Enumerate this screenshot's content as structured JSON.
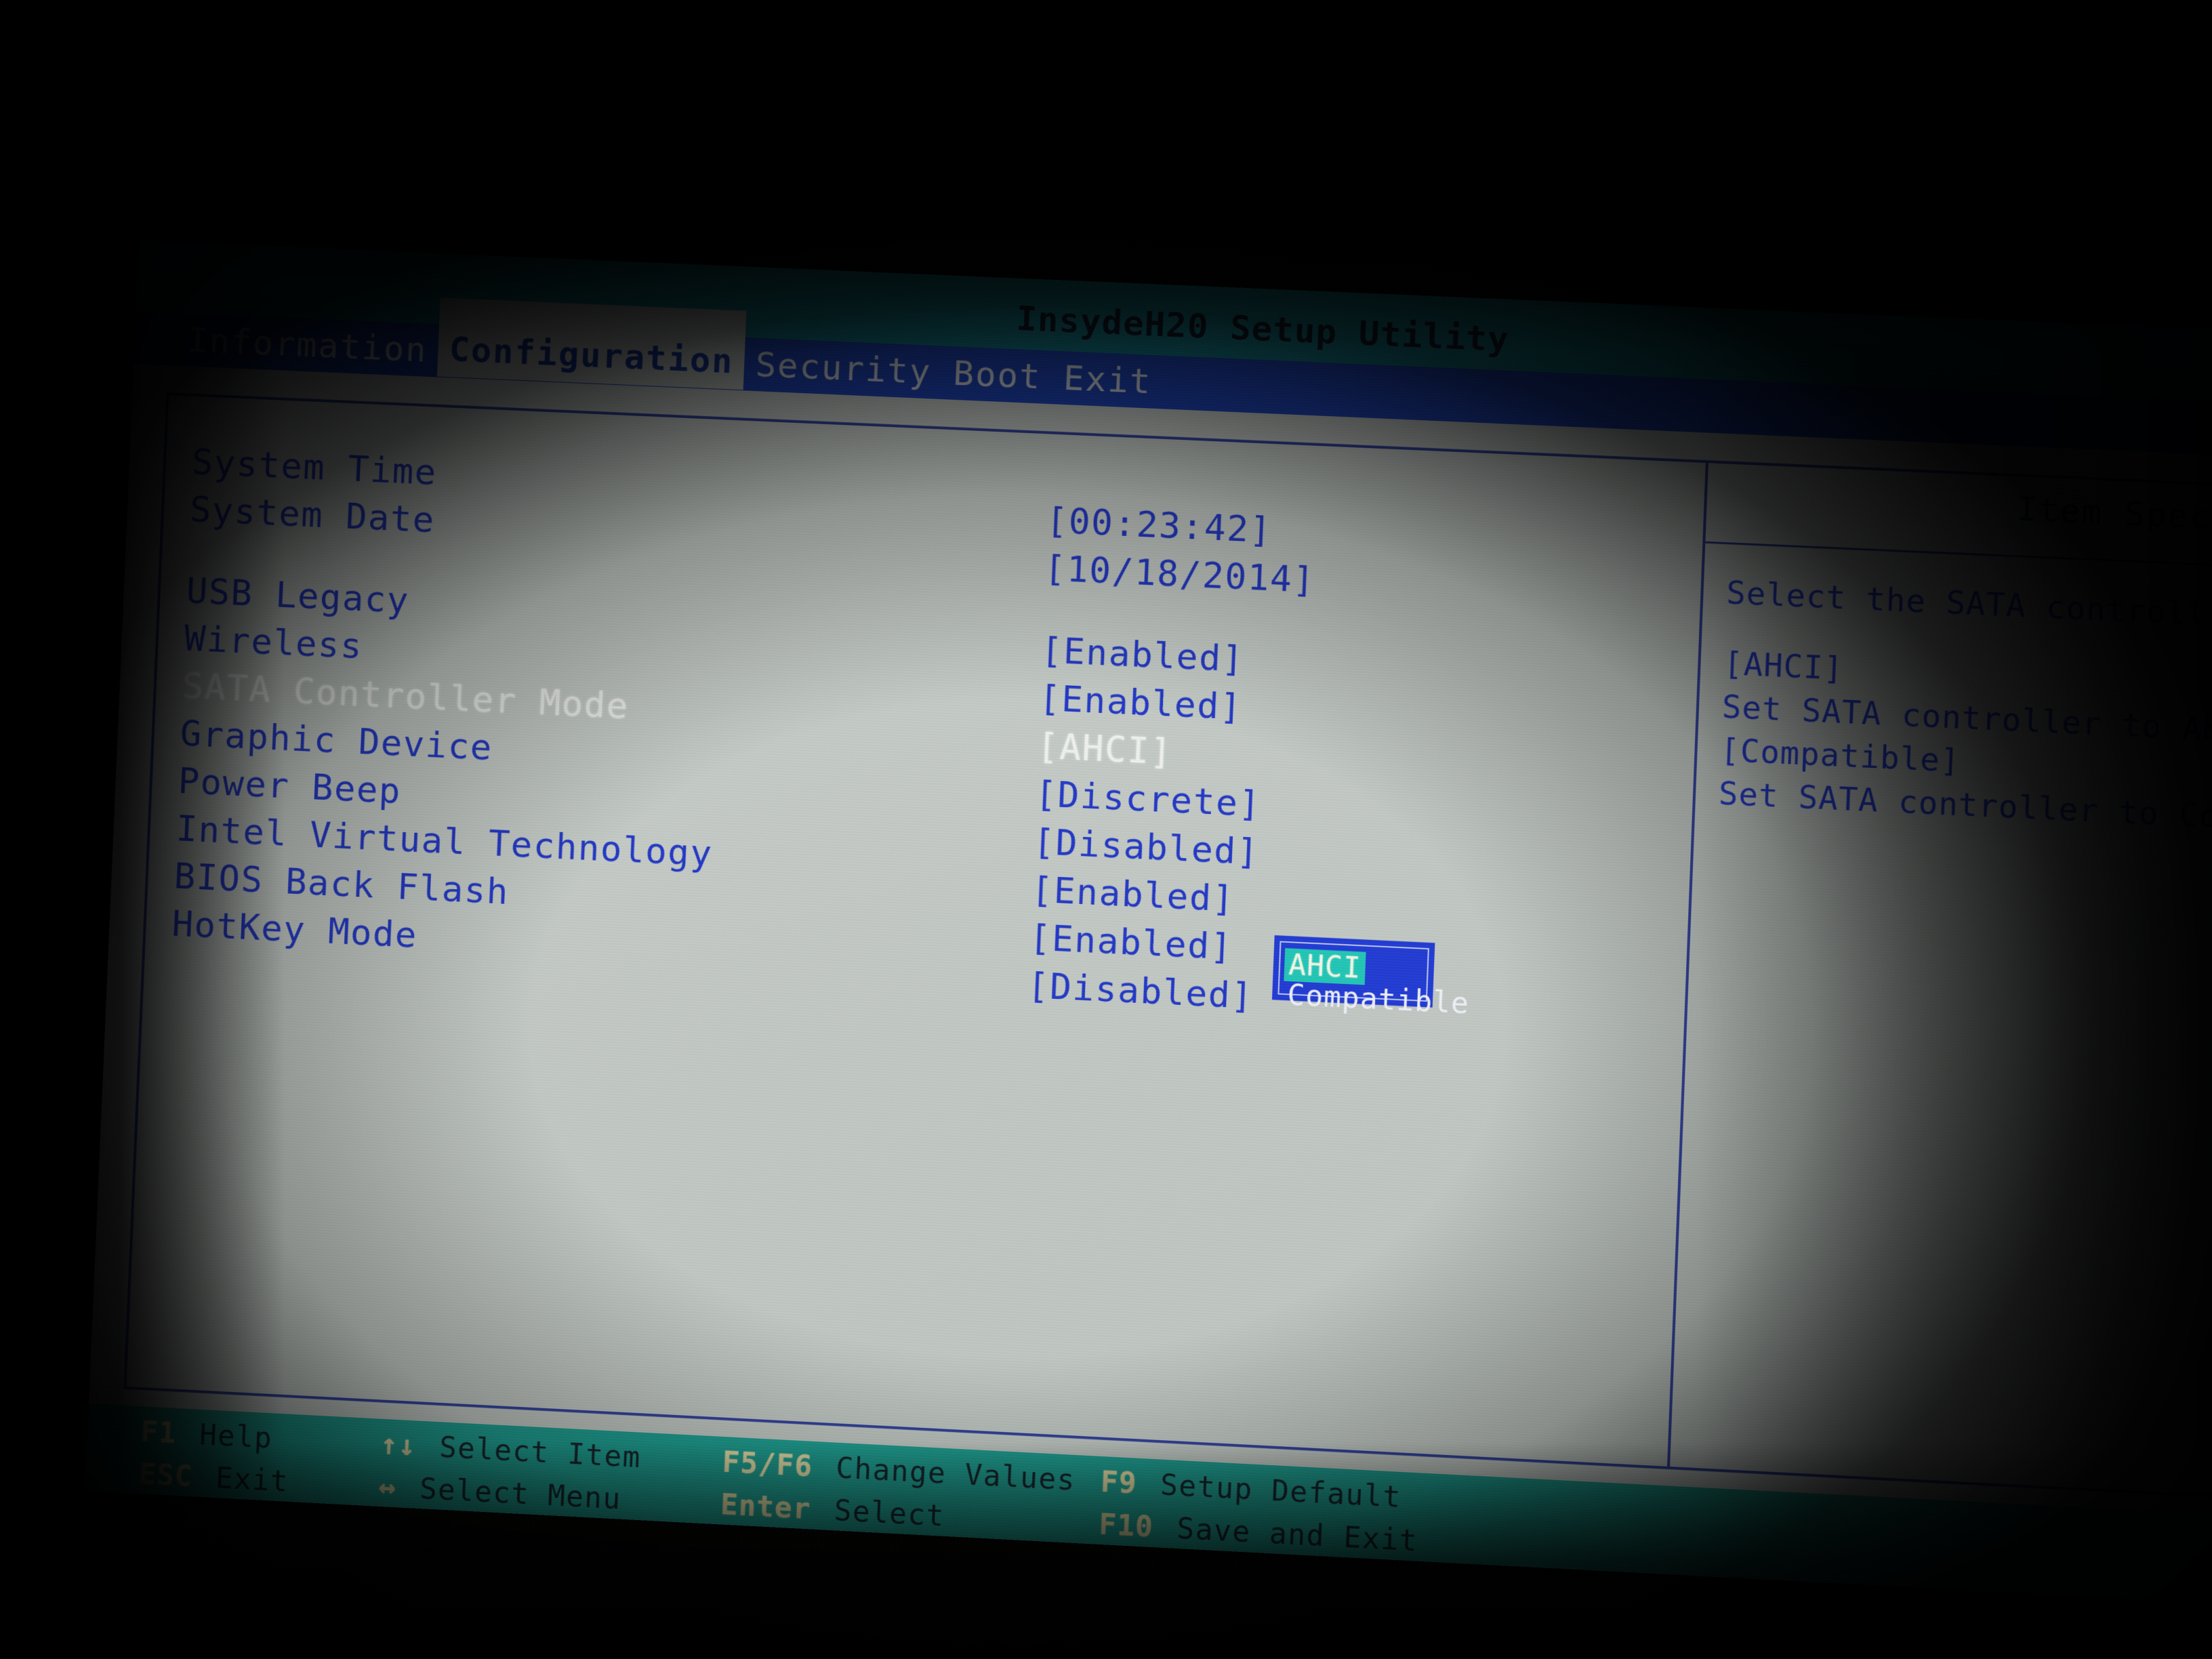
{
  "app": {
    "title": "InsydeH20 Setup Utility"
  },
  "menu": {
    "items": [
      {
        "label": "Information",
        "active": false
      },
      {
        "label": "Configuration",
        "active": true
      },
      {
        "label": "Security",
        "active": false
      },
      {
        "label": "Boot",
        "active": false
      },
      {
        "label": "Exit",
        "active": false
      }
    ]
  },
  "settings": {
    "rows": [
      {
        "label": "System Time",
        "value": "[00:23:42]",
        "selected": false,
        "gap": false
      },
      {
        "label": "System Date",
        "value": "[10/18/2014]",
        "selected": false,
        "gap": false
      },
      {
        "label": "USB Legacy",
        "value": "[Enabled]",
        "selected": false,
        "gap": true
      },
      {
        "label": "Wireless",
        "value": "[Enabled]",
        "selected": false,
        "gap": false
      },
      {
        "label": "SATA Controller Mode",
        "value": "[AHCI]",
        "selected": true,
        "gap": false
      },
      {
        "label": "Graphic Device",
        "value": "[Discrete]",
        "selected": false,
        "gap": false
      },
      {
        "label": "Power Beep",
        "value": "[Disabled]",
        "selected": false,
        "gap": false
      },
      {
        "label": "Intel Virtual Technology",
        "value": "[Enabled]",
        "selected": false,
        "gap": false
      },
      {
        "label": "BIOS Back Flash",
        "value": "[Enabled]",
        "selected": false,
        "gap": false
      },
      {
        "label": "HotKey Mode",
        "value": "[Disabled]",
        "selected": false,
        "gap": false
      }
    ]
  },
  "help": {
    "title": "Item Specific Help",
    "lines": [
      "Select the SATA controller mode.",
      "",
      "[AHCI]",
      "Set SATA controller to AHCI mode.",
      "[Compatible]",
      "Set SATA controller to Compatible mode."
    ]
  },
  "popup": {
    "options": [
      {
        "label": "AHCI",
        "highlighted": true
      },
      {
        "label": "Compatible",
        "highlighted": false
      }
    ]
  },
  "keybar": {
    "row1": [
      {
        "key": "F1",
        "desc": "Help"
      },
      {
        "key": "↑↓",
        "desc": "Select Item"
      },
      {
        "key": "F5/F6",
        "desc": "Change Values"
      },
      {
        "key": "F9",
        "desc": "Setup Default"
      }
    ],
    "row2": [
      {
        "key": "ESC",
        "desc": "Exit"
      },
      {
        "key": "↔",
        "desc": "Select Menu"
      },
      {
        "key": "Enter",
        "desc": "Select"
      },
      {
        "key": "F10",
        "desc": "Save and Exit"
      }
    ]
  },
  "colors": {
    "title_band": "#159aa9",
    "menu_bar": "#1b44c4",
    "screen_bg": "#c6cdc8",
    "text_blue": "#1f35c8",
    "text_selected": "#f2f5f2",
    "popup_bg": "#1f39d6",
    "popup_highlight": "#1fc8b8",
    "keybar_bg": "#1aa092",
    "key_label": "#ece4a8"
  }
}
